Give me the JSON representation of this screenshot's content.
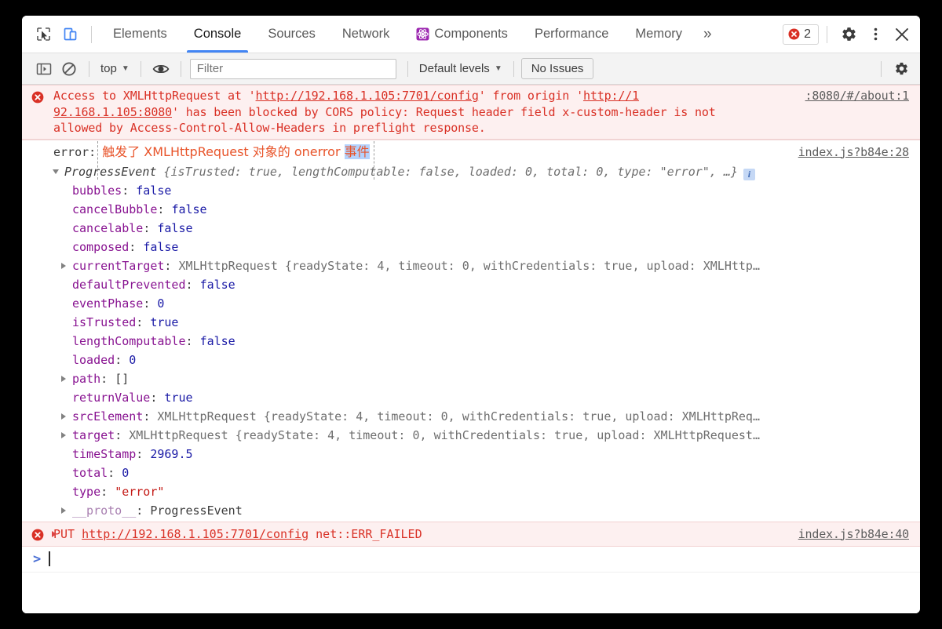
{
  "window": {
    "title": "Chrome DevTools"
  },
  "tabbar": {
    "inspect_icon": "inspect-cursor-icon",
    "device_icon": "device-toolbar-icon",
    "tabs": [
      {
        "label": "Elements",
        "active": false,
        "icon": null
      },
      {
        "label": "Console",
        "active": true,
        "icon": null
      },
      {
        "label": "Sources",
        "active": false,
        "icon": null
      },
      {
        "label": "Network",
        "active": false,
        "icon": null
      },
      {
        "label": "Components",
        "active": false,
        "icon": "react-components-icon"
      },
      {
        "label": "Performance",
        "active": false,
        "icon": null
      },
      {
        "label": "Memory",
        "active": false,
        "icon": null
      }
    ],
    "overflow_label": "»",
    "error_badge": {
      "count": "2",
      "icon": "error-circle-icon"
    },
    "settings_icon": "gear-icon",
    "more_icon": "kebab-menu-icon",
    "close_icon": "close-icon"
  },
  "console_toolbar": {
    "sidebar_toggle_icon": "console-sidebar-icon",
    "clear_icon": "clear-console-icon",
    "context_selector": {
      "label": "top",
      "caret": "▼"
    },
    "eye_icon": "live-expression-icon",
    "filter": {
      "placeholder": "Filter",
      "value": ""
    },
    "levels_selector": {
      "label": "Default levels",
      "caret": "▼"
    },
    "issues_button": "No Issues",
    "settings_icon": "gear-icon"
  },
  "console": {
    "cors_error": {
      "icon": "error-circle-icon",
      "segments": [
        {
          "t": "Access to XMLHttpRequest at '",
          "u": false
        },
        {
          "t": "http://192.168.1.105:7701/config",
          "u": true
        },
        {
          "t": "' from origin '",
          "u": false
        },
        {
          "t": "http://1",
          "u": true
        },
        {
          "t": "\n92.168.1.105:8080",
          "u": true
        },
        {
          "t": "' has been blocked by CORS policy: Request header field x-custom-header is not\nallowed by Access-Control-Allow-Headers in preflight response.",
          "u": false
        }
      ],
      "source": ":8080/#/about:1"
    },
    "chinese_log": {
      "label": "error:",
      "text_before_selection": "触发了 XMLHttpRequest 对象的 onerror ",
      "selected_text": "事件",
      "source": "index.js?b84e:28"
    },
    "progress_event": {
      "header": {
        "class_name": "ProgressEvent",
        "preview": " {isTrusted: true, lengthComputable: false, loaded: 0, total: 0, type: \"error\", …}",
        "info_icon": "info-icon"
      },
      "properties": [
        {
          "expandable": false,
          "name": "bubbles",
          "value": "false",
          "kind": "bool"
        },
        {
          "expandable": false,
          "name": "cancelBubble",
          "value": "false",
          "kind": "bool"
        },
        {
          "expandable": false,
          "name": "cancelable",
          "value": "false",
          "kind": "bool"
        },
        {
          "expandable": false,
          "name": "composed",
          "value": "false",
          "kind": "bool"
        },
        {
          "expandable": true,
          "name": "currentTarget",
          "value": "XMLHttpRequest {readyState: 4, timeout: 0, withCredentials: true, upload: XMLHttp…",
          "kind": "object"
        },
        {
          "expandable": false,
          "name": "defaultPrevented",
          "value": "false",
          "kind": "bool"
        },
        {
          "expandable": false,
          "name": "eventPhase",
          "value": "0",
          "kind": "num"
        },
        {
          "expandable": false,
          "name": "isTrusted",
          "value": "true",
          "kind": "bool"
        },
        {
          "expandable": false,
          "name": "lengthComputable",
          "value": "false",
          "kind": "bool"
        },
        {
          "expandable": false,
          "name": "loaded",
          "value": "0",
          "kind": "num"
        },
        {
          "expandable": true,
          "name": "path",
          "value": "[]",
          "kind": "plain"
        },
        {
          "expandable": false,
          "name": "returnValue",
          "value": "true",
          "kind": "bool"
        },
        {
          "expandable": true,
          "name": "srcElement",
          "value": "XMLHttpRequest {readyState: 4, timeout: 0, withCredentials: true, upload: XMLHttpReq…",
          "kind": "object"
        },
        {
          "expandable": true,
          "name": "target",
          "value": "XMLHttpRequest {readyState: 4, timeout: 0, withCredentials: true, upload: XMLHttpRequest…",
          "kind": "object"
        },
        {
          "expandable": false,
          "name": "timeStamp",
          "value": "2969.5",
          "kind": "num"
        },
        {
          "expandable": false,
          "name": "total",
          "value": "0",
          "kind": "num"
        },
        {
          "expandable": false,
          "name": "type",
          "value": "\"error\"",
          "kind": "str"
        },
        {
          "expandable": true,
          "name": "__proto__",
          "value": "ProgressEvent",
          "kind": "plain",
          "proto": true
        }
      ]
    },
    "put_error": {
      "icon": "error-circle-icon",
      "method": "PUT",
      "url": "http://192.168.1.105:7701/config",
      "status": "net::ERR_FAILED",
      "source": "index.js?b84e:40"
    },
    "prompt": {
      "caret": ">",
      "value": ""
    }
  },
  "colors": {
    "accent": "#4285f4",
    "error_red": "#d93025",
    "error_bg": "#fdf0f0",
    "chinese_orange": "#e8542a",
    "selection_blue": "#b4d2fd",
    "key_purple": "#881391",
    "value_blue": "#1a1aa6",
    "string_red": "#c41a16"
  }
}
